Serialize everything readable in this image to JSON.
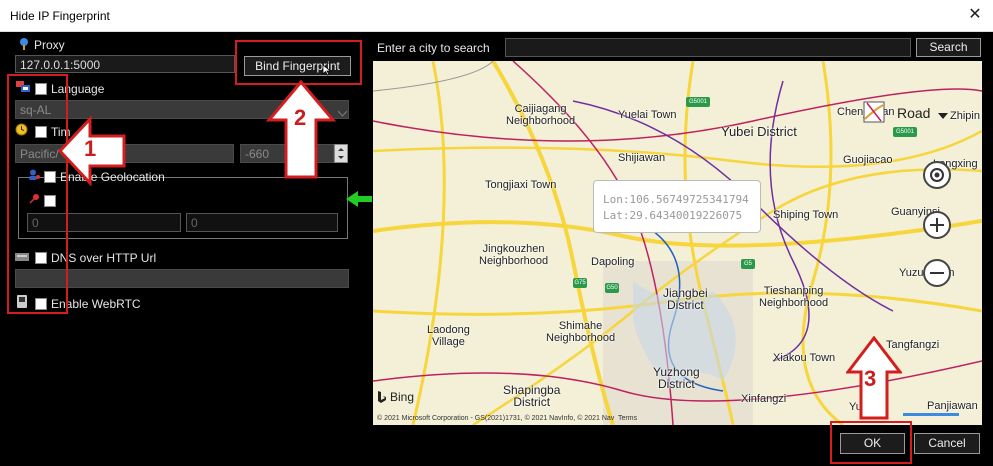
{
  "window": {
    "title": "Hide IP Fingerprint",
    "close_glyph": "✕"
  },
  "proxy": {
    "label": "Proxy",
    "value": "127.0.0.1:5000"
  },
  "bind_button": {
    "label": "Bind Fingerprint"
  },
  "language": {
    "label": "Language",
    "value": "sq-AL"
  },
  "timezone": {
    "label": "Tim",
    "value": "Pacific/",
    "offset": "-660"
  },
  "geolocation": {
    "label": "Enable Geolocation",
    "lat": "0",
    "lon": "0"
  },
  "dns": {
    "label": "DNS over HTTP Url",
    "value": ""
  },
  "webrtc": {
    "label": "Enable WebRTC"
  },
  "search": {
    "label": "Enter a city to search",
    "value": "",
    "button": "Search"
  },
  "map": {
    "style_label": "Road",
    "coord_lon": "Lon:106.56749725341794",
    "coord_lat": "Lat:29.64340019226075",
    "bing": "Bing",
    "copyright": "© 2021 Microsoft Corporation - GS(2021)1731, © 2021 NavInfo, © 2021 Nav  Terms",
    "places": [
      {
        "text": "Caijiagang\nNeighborhood"
      },
      {
        "text": "Yuelai Town"
      },
      {
        "text": "Yubei District"
      },
      {
        "text": "Chenjiawan"
      },
      {
        "text": "Zhipin"
      },
      {
        "text": "Shijiawan"
      },
      {
        "text": "Guojiacao"
      },
      {
        "text": "Longxing"
      },
      {
        "text": "Tongjiaxi Town"
      },
      {
        "text": "Shiping Town"
      },
      {
        "text": "Guanyinsi"
      },
      {
        "text": "Jingkouzhen\nNeighborhood"
      },
      {
        "text": "Dapoling"
      },
      {
        "text": "Yuzui Town"
      },
      {
        "text": "Jiangbei\nDistrict"
      },
      {
        "text": "Tieshanping\nNeighborhood"
      },
      {
        "text": "Laodong\nVillage"
      },
      {
        "text": "Shimahe\nNeighborhood"
      },
      {
        "text": "Tangfangzi"
      },
      {
        "text": "Xiakou Town"
      },
      {
        "text": "Yuzhong\nDistrict"
      },
      {
        "text": "Shapingba\nDistrict"
      },
      {
        "text": "Xinfangzi"
      },
      {
        "text": "Panjiawan"
      },
      {
        "text": "Yu"
      }
    ],
    "road_badges": [
      "G5001",
      "G5001",
      "G75",
      "G50",
      "G5"
    ]
  },
  "ok_button": {
    "label": "OK"
  },
  "cancel_button": {
    "label": "Cancel"
  },
  "annotations": {
    "n1": "1",
    "n2": "2",
    "n3": "3"
  },
  "colors": {
    "annotation_red": "#d21e1e",
    "arrow_green": "#22cc22",
    "map_bg": "#f3f0d7",
    "road_yellow": "#f7d53c"
  }
}
